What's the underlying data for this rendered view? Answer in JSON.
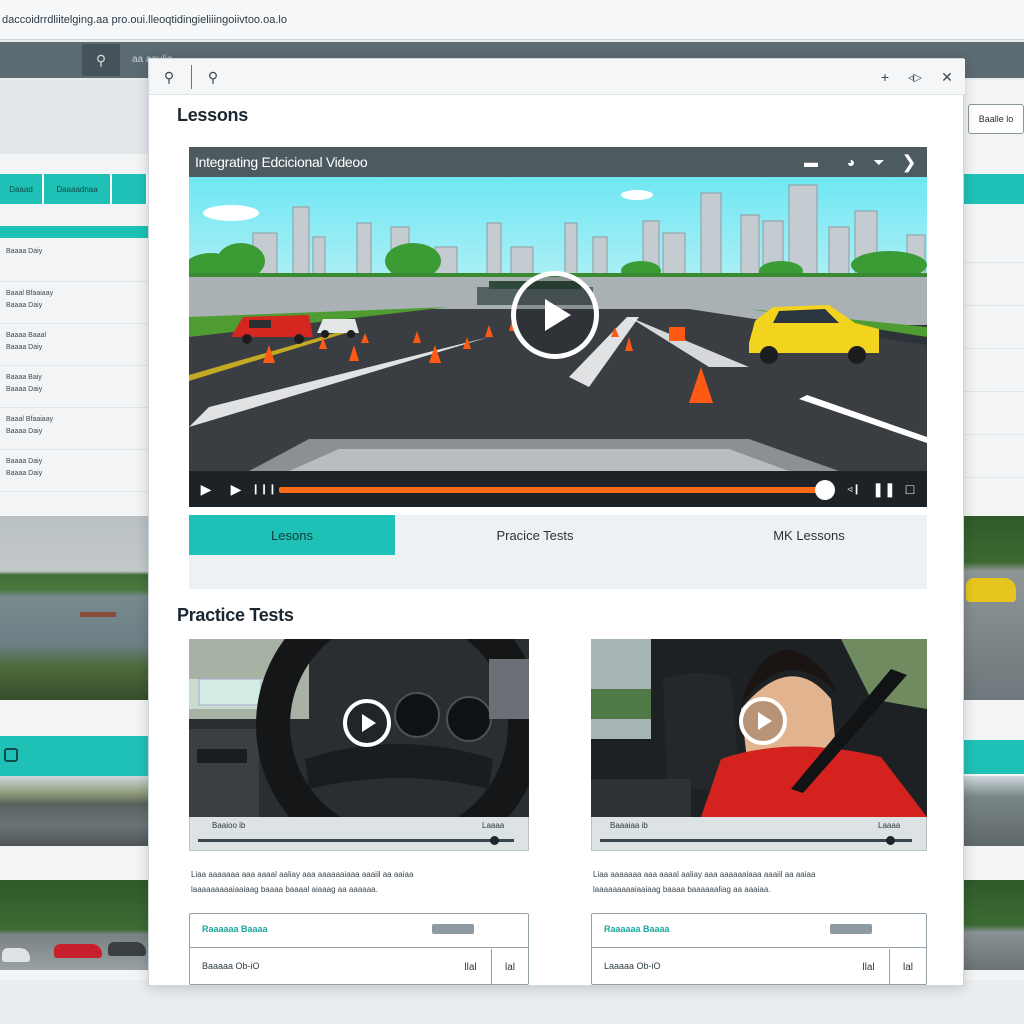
{
  "browser": {
    "url": "daccoidrrdliitelging.aa pro.oui.lleoqtidingieliiingoiivtoo.oa.lo",
    "tab_label": "aa aoulia",
    "search_icon": "search-icon"
  },
  "background": {
    "left_tabs": [
      "Daaad",
      "Daaaadnaa"
    ],
    "left_items": [
      [
        "Baaaa Daiy"
      ],
      [
        "Baaal Bfaaiaay",
        "Baaaa Daiy"
      ],
      [
        "Baaaa Baaal",
        "Baaaa Daiy"
      ],
      [
        "Baaaa Baiy",
        "Baaaa Daiy"
      ],
      [
        "Baaal Bfaaiaay",
        "Baaaa Daiy"
      ],
      [
        "Baaaa Daiy",
        "Baaaa Daiy"
      ]
    ],
    "right_button": "Baalle lo"
  },
  "modal": {
    "toolbar_icons": [
      "search-icon",
      "search-icon",
      "plus-icon",
      "split-icon",
      "close-icon"
    ],
    "lessons_title": "Lessons",
    "player": {
      "title": "Integrating Edcicional Videoo",
      "progress": 1.0
    },
    "tabs": [
      {
        "label": "Lesons",
        "active": true
      },
      {
        "label": "Pracice Tests",
        "active": false
      },
      {
        "label": "MK Lessons",
        "active": false
      }
    ],
    "practice_title": "Practice Tests",
    "cards": [
      {
        "time_left": "Baaioo ib",
        "time_right": "Laaaa",
        "desc_line1": "Liaa aaaaaaa aaa aaaal aaliay aaa aaaaaaiaaa aaaiil aa aaiaa",
        "desc_line2": "laaaaaaaaaiaaiaag baaaa baaaal aiaaag aa aaaaaa.",
        "label_top": "Raaaaaa Baaaa",
        "label_bottom": "Baaaaa Ob-iO",
        "cell_a": "llal",
        "cell_b": "lal"
      },
      {
        "time_left": "Baaaiaa ib",
        "time_right": "Laaaa",
        "desc_line1": "Liaa aaaaaaa aaa aaaal aaliay aaa aaaaaaiaaa aaaiil aa aaiaa",
        "desc_line2": "laaaaaaaaaiaaiaag baaaa baaaaaaliag aa aaaiaa.",
        "label_top": "Raaaaaa Baaaa",
        "label_bottom": "Laaaaa Ob-iO",
        "cell_a": "llal",
        "cell_b": "lal"
      }
    ]
  },
  "colors": {
    "accent": "#1fc1b6",
    "progress": "#ff6a1a",
    "player_bar": "#4d5a60"
  }
}
